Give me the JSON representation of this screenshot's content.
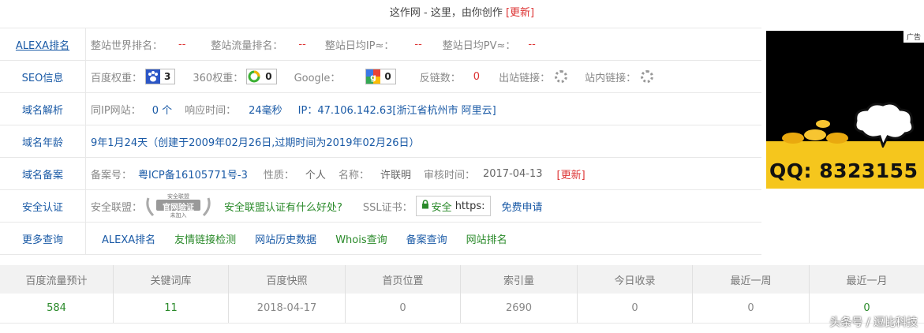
{
  "header": {
    "title": "这作网 - 这里，由你创作",
    "update": "[更新]"
  },
  "rows": {
    "alexa": {
      "label": "ALEXA排名",
      "world_label": "整站世界排名：",
      "world_value": "--",
      "traffic_label": "整站流量排名：",
      "traffic_value": "--",
      "ip_label": "整站日均IP≈：",
      "ip_value": "--",
      "pv_label": "整站日均PV≈：",
      "pv_value": "--"
    },
    "seo": {
      "label": "SEO信息",
      "baidu_label": "百度权重：",
      "baidu_value": "3",
      "s360_label": "360权重：",
      "s360_value": "0",
      "google_label": "Google：",
      "google_value": "0",
      "backlinks_label": "反链数：",
      "backlinks_value": "0",
      "outlinks_label": "出站链接：",
      "inlinks_label": "站内链接："
    },
    "dns": {
      "label": "域名解析",
      "sameip_label": "同IP网站：",
      "sameip_value": "0 个",
      "resp_label": "响应时间：",
      "resp_value": "24毫秒",
      "ip_text": "IP：47.106.142.63[浙江省杭州市 阿里云]"
    },
    "age": {
      "label": "域名年龄",
      "text": "9年1月24天（创建于2009年02月26日,过期时间为2019年02月26日）"
    },
    "icp": {
      "label": "域名备案",
      "no_label": "备案号：",
      "no_value": "粤ICP备16105771号-3",
      "nature_label": "性质：",
      "nature_value": "个人",
      "name_label": "名称：",
      "name_value": "许联明",
      "date_label": "审核时间：",
      "date_value": "2017-04-13",
      "update": "[更新]"
    },
    "security": {
      "label": "安全认证",
      "union_label": "安全联盟：",
      "seal_top": "安全联盟",
      "seal_mid": "官网验证",
      "seal_bottom": "未加入",
      "union_link": "安全联盟认证有什么好处?",
      "ssl_label": "SSL证书：",
      "ssl_safe": "安全",
      "ssl_https": "https:",
      "ssl_link": "免费申请"
    },
    "more": {
      "label": "更多查询",
      "links": [
        "ALEXA排名",
        "友情链接检测",
        "网站历史数据",
        "Whois查询",
        "备案查询",
        "网站排名"
      ]
    }
  },
  "ad": {
    "tag": "广告",
    "qq": "QQ: 8323155"
  },
  "stats": {
    "headers": [
      "百度流量预计",
      "关键词库",
      "百度快照",
      "首页位置",
      "索引量",
      "今日收录",
      "最近一周",
      "最近一月"
    ],
    "values": [
      "584",
      "11",
      "2018-04-17",
      "0",
      "2690",
      "0",
      "0",
      "0"
    ]
  },
  "watermark": "头条号 / 逗比科技",
  "colors": {
    "link_blue": "#1a5aa6",
    "value_red": "#dd3333",
    "ok_green": "#2a8a2a",
    "ad_gold": "#f5c61d"
  }
}
